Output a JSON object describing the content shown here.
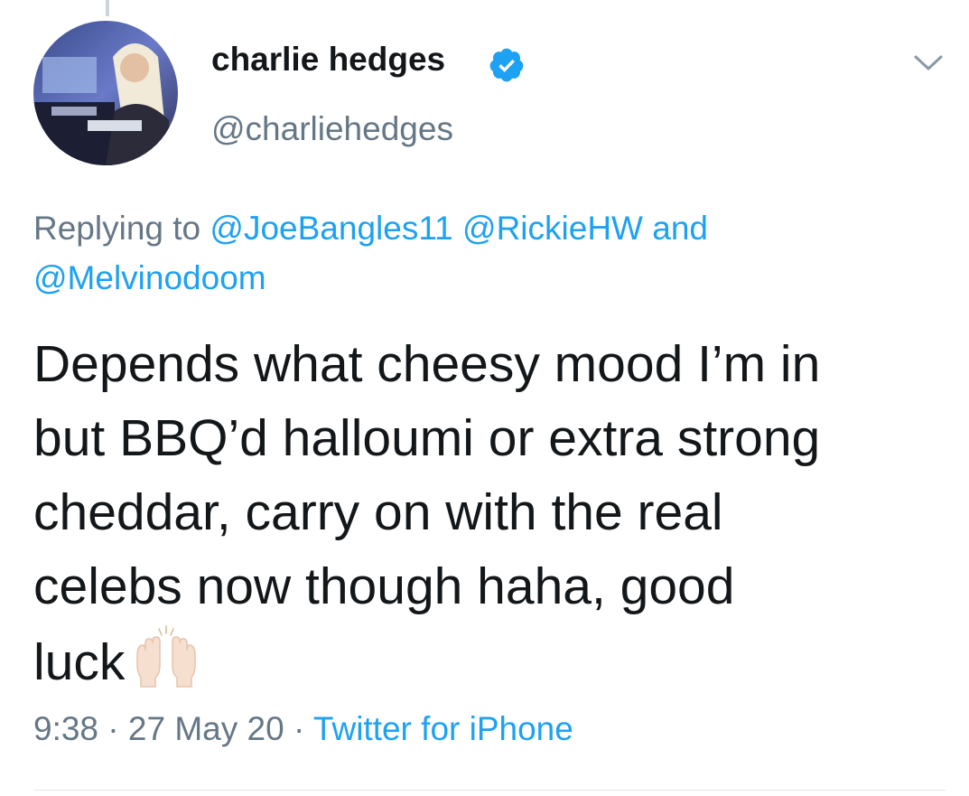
{
  "tweet": {
    "author": {
      "display_name": "charlie hedges",
      "handle": "@charliehedges",
      "verified": true,
      "avatar_icon": "profile-photo"
    },
    "replying_prefix": "Replying to",
    "mentions": [
      "@JoeBangles11",
      "@RickieHW",
      "@Melvinodoom"
    ],
    "mentions_joiner": "and",
    "text_lines": [
      "Depends what cheesy mood I’m in",
      "but BBQ’d halloumi or extra strong",
      "cheddar, carry on with the real",
      "celebs now though haha, good",
      "luck"
    ],
    "trailing_emoji": "raising-hands-light-skin-tone",
    "time": "9:38",
    "date": "27 May 20",
    "separator": "·",
    "source": "Twitter for iPhone"
  },
  "colors": {
    "text": "#14171a",
    "secondary": "#657786",
    "link": "#1da1f2",
    "verified": "#1da1f2",
    "divider": "#e1e8ed"
  },
  "icons": {
    "verified": "verified-badge-icon",
    "menu": "chevron-down-icon",
    "emoji": "raising-hands-icon"
  }
}
